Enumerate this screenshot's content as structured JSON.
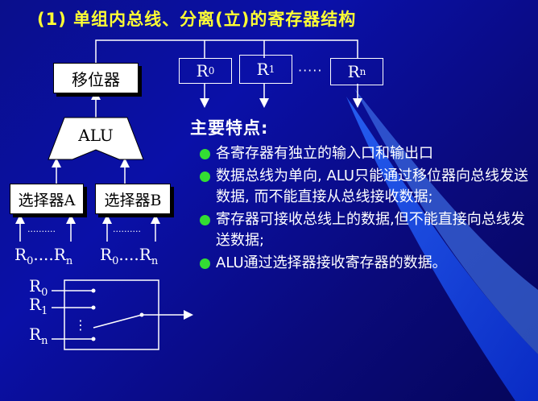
{
  "title": "(1) 单组内总线、分离(立)的寄存器结构",
  "diagram": {
    "shifter_label": "移位器",
    "alu_label": "ALU",
    "selector_a_label": "选择器A",
    "selector_b_label": "选择器B",
    "registers": [
      {
        "base": "R",
        "sub": "0"
      },
      {
        "base": "R",
        "sub": "1"
      },
      {
        "base": "R",
        "sub": "n"
      }
    ],
    "register_ellipsis": "·····",
    "selector_a_inputs": {
      "first": {
        "base": "R",
        "sub": "0"
      },
      "sep": "....",
      "last": {
        "base": "R",
        "sub": "n"
      }
    },
    "selector_b_inputs": {
      "first": {
        "base": "R",
        "sub": "0"
      },
      "sep": "....",
      "last": {
        "base": "R",
        "sub": "n"
      }
    },
    "input_dots": "..........",
    "switch_inputs": [
      {
        "base": "R",
        "sub": "0"
      },
      {
        "base": "R",
        "sub": "1"
      },
      {
        "base": "R",
        "sub": "n"
      }
    ],
    "switch_vdots": "⋮"
  },
  "features": {
    "heading": "主要特点:",
    "items": [
      "各寄存器有独立的输入口和输出口",
      "数据总线为单向, ALU只能通过移位器向总线发送数据, 而不能直接从总线接收数据;",
      "寄存器可接收总线上的数据,但不能直接向总线发送数据;",
      "ALU通过选择器接收寄存器的数据。"
    ]
  },
  "colors": {
    "background": "#0a10a8",
    "title": "#ffff33",
    "swoosh": "#3a7bff",
    "bullet": "#33dd33"
  }
}
